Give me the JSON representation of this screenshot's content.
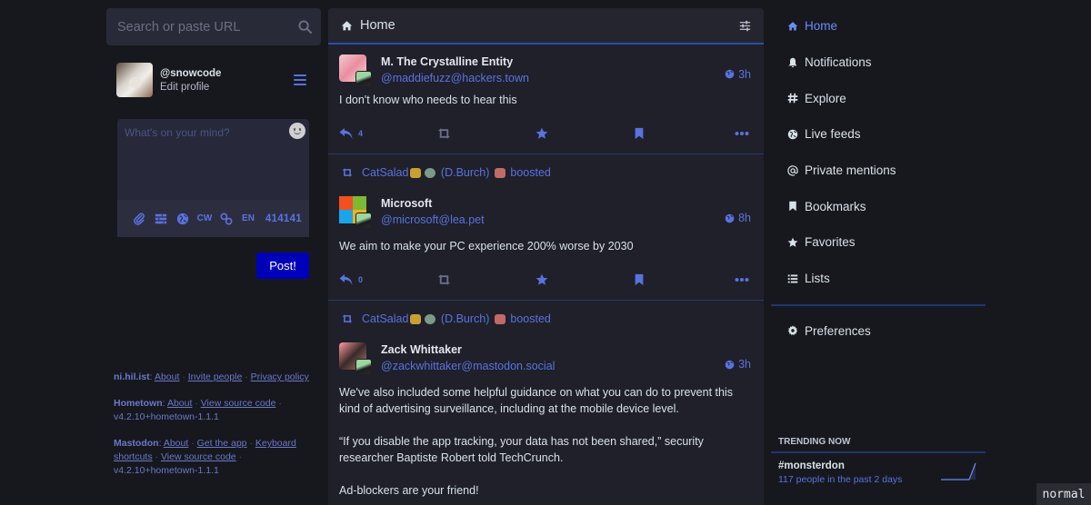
{
  "search": {
    "placeholder": "Search or paste URL"
  },
  "profile": {
    "handle": "@snowcode",
    "edit_label": "Edit profile"
  },
  "composer": {
    "placeholder": "What's on your mind?",
    "cw_label": "CW",
    "lang_label": "EN",
    "char_counter": "414141",
    "post_label": "Post!"
  },
  "footer": {
    "instance": {
      "name": "ni.hil.ist",
      "links": [
        "About",
        "Invite people",
        "Privacy policy"
      ]
    },
    "hometown": {
      "name": "Hometown",
      "links": [
        "About",
        "View source code"
      ],
      "version": "v4.2.10+hometown-1.1.1"
    },
    "mastodon": {
      "name": "Mastodon",
      "links": [
        "About",
        "Get the app",
        "Keyboard shortcuts",
        "View source code"
      ],
      "version": "v4.2.10+hometown-1.1.1"
    }
  },
  "column": {
    "title": "Home"
  },
  "statuses": [
    {
      "boosted_by": null,
      "display_name": "M. The Crystalline Entity",
      "account": "@maddiefuzz@hackers.town",
      "time": "3h",
      "content": [
        "I don't know who needs to hear this"
      ],
      "replies": "4"
    },
    {
      "boosted_by": "CatSalad",
      "boost_suffix_name": "(D.Burch)",
      "boost_label": "boosted",
      "display_name": "Microsoft",
      "account": "@microsoft@lea.pet",
      "time": "8h",
      "content": [
        "We aim to make your PC experience 200% worse by 2030"
      ],
      "replies": "0"
    },
    {
      "boosted_by": "CatSalad",
      "boost_suffix_name": "(D.Burch)",
      "boost_label": "boosted",
      "display_name": "Zack Whittaker",
      "account": "@zackwhittaker@mastodon.social",
      "time": "3h",
      "content": [
        "We've also included some helpful guidance on what you can do to prevent this kind of advertising surveillance, including at the mobile device level.",
        "“If you disable the app tracking, your data has not been shared,” security researcher Baptiste Robert told TechCrunch.",
        "Ad-blockers are your friend!"
      ]
    }
  ],
  "nav": {
    "items": [
      {
        "label": "Home",
        "icon": "home-icon",
        "active": true
      },
      {
        "label": "Notifications",
        "icon": "bell-icon"
      },
      {
        "label": "Explore",
        "icon": "hashtag-icon"
      },
      {
        "label": "Live feeds",
        "icon": "globe-icon"
      },
      {
        "label": "Private mentions",
        "icon": "at-icon"
      },
      {
        "label": "Bookmarks",
        "icon": "bookmark-icon"
      },
      {
        "label": "Favorites",
        "icon": "star-icon"
      },
      {
        "label": "Lists",
        "icon": "list-icon"
      }
    ],
    "preferences": "Preferences"
  },
  "trending": {
    "heading": "TRENDING NOW",
    "items": [
      {
        "tag": "#monsterdon",
        "meta": "117 people in the past 2 days"
      }
    ]
  },
  "mode_indicator": "normal",
  "colors": {
    "accent": "#5a72e0",
    "post_button": "#0000b8",
    "active_nav": "#6a8cf5",
    "background": "#17181e"
  }
}
